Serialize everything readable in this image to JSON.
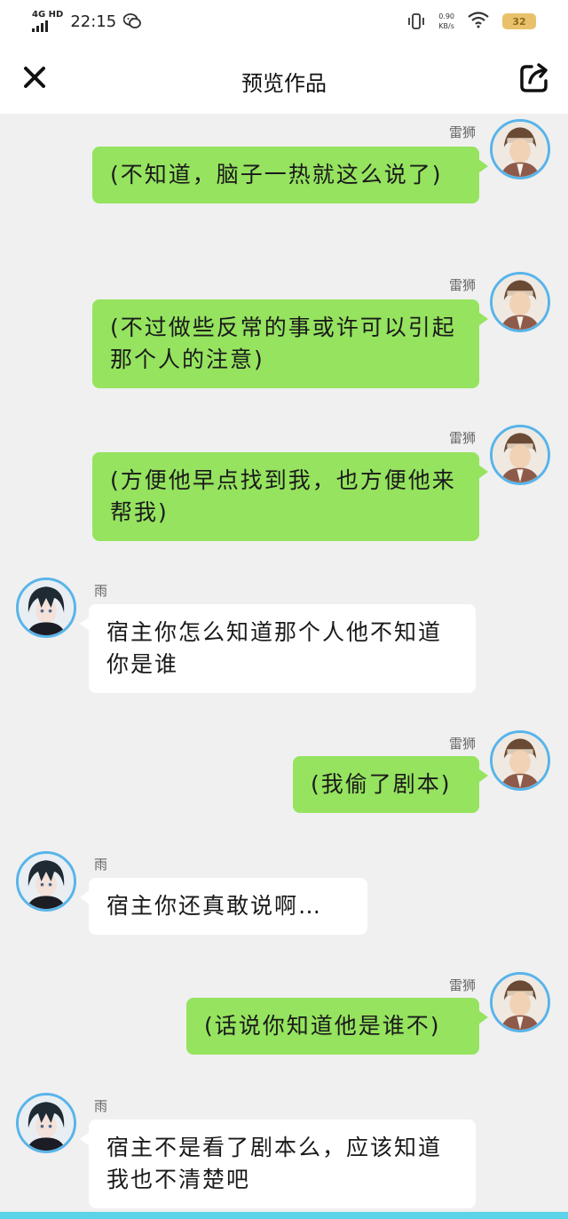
{
  "status_bar": {
    "network": "4G HD",
    "time": "22:15",
    "speed_value": "0.90",
    "speed_unit": "KB/s",
    "battery": "32"
  },
  "header": {
    "title": "预览作品"
  },
  "colors": {
    "bubble_right": "#95e35f",
    "bubble_left": "#ffffff",
    "avatar_ring": "#58b4ea",
    "background": "#f0f0f0"
  },
  "messages": [
    {
      "side": "right",
      "sender": "雷狮",
      "text": "(不知道，脑子一热就这么说了)"
    },
    {
      "side": "right",
      "sender": "雷狮",
      "text": "(不过做些反常的事或许可以引起那个人的注意)"
    },
    {
      "side": "right",
      "sender": "雷狮",
      "text": "(方便他早点找到我，也方便他来帮我)"
    },
    {
      "side": "left",
      "sender": "雨",
      "text": "宿主你怎么知道那个人他不知道你是谁"
    },
    {
      "side": "right",
      "sender": "雷狮",
      "text": "(我偷了剧本)"
    },
    {
      "side": "left",
      "sender": "雨",
      "text": "宿主你还真敢说啊…"
    },
    {
      "side": "right",
      "sender": "雷狮",
      "text": "(话说你知道他是谁不)"
    },
    {
      "side": "left",
      "sender": "雨",
      "text": "宿主不是看了剧本么，应该知道我也不清楚吧"
    }
  ]
}
